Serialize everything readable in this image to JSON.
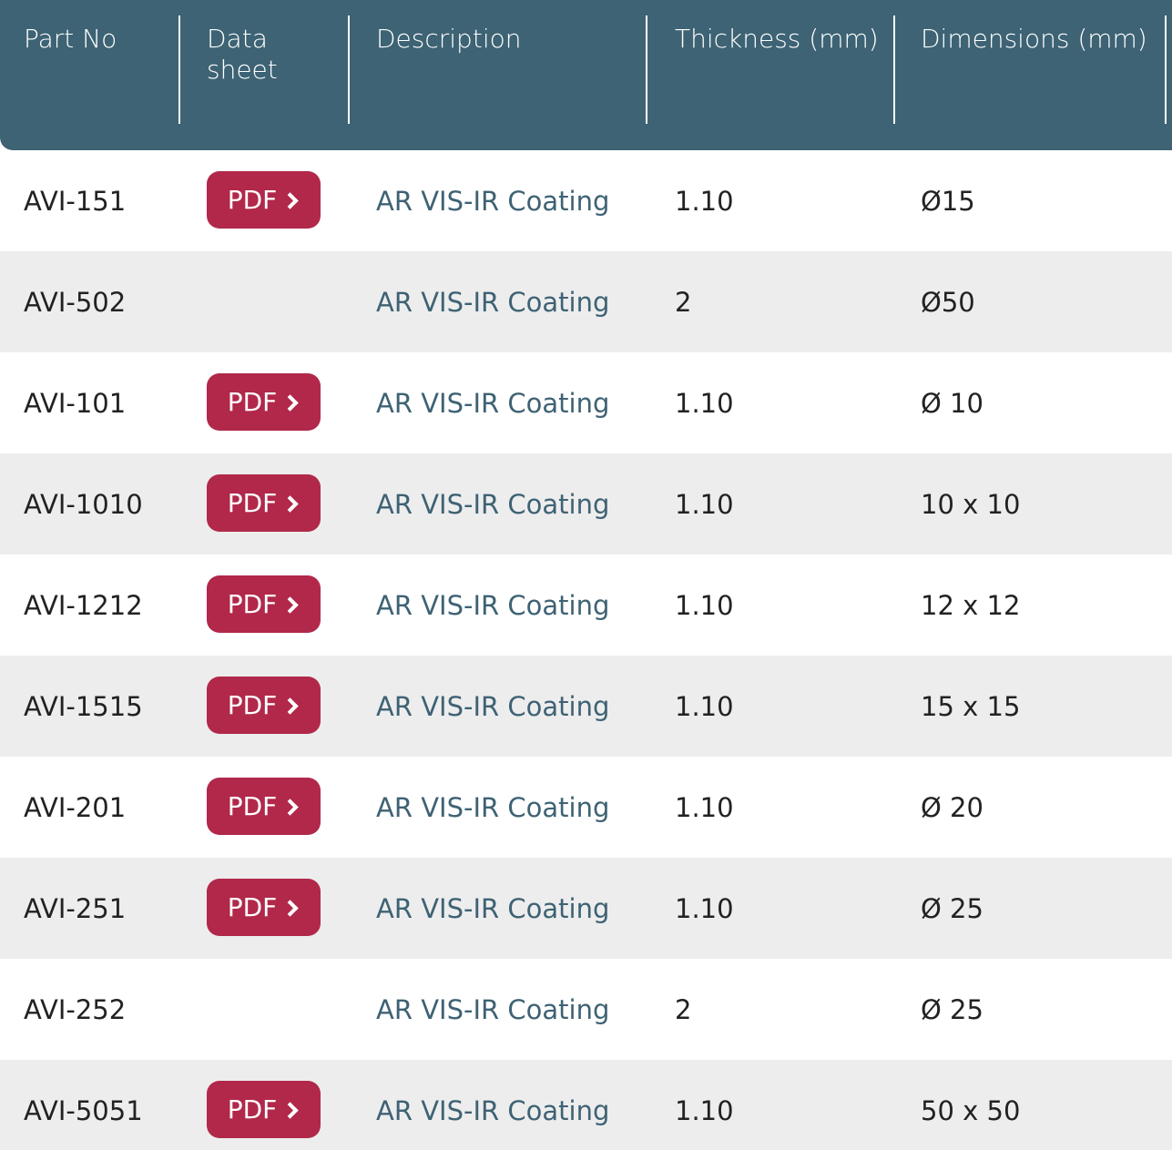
{
  "header": {
    "part_no": "Part No",
    "data_sheet": "Data sheet",
    "description": "Description",
    "thickness": "Thickness (mm)",
    "dimensions": "Dimensions (mm)"
  },
  "pdf_label": "PDF",
  "rows": [
    {
      "part_no": "AVI-151",
      "has_pdf": true,
      "description": "AR VIS-IR Coating",
      "thickness": "1.10",
      "dimensions": "Ø15"
    },
    {
      "part_no": "AVI-502",
      "has_pdf": false,
      "description": "AR VIS-IR Coating",
      "thickness": "2",
      "dimensions": "Ø50"
    },
    {
      "part_no": "AVI-101",
      "has_pdf": true,
      "description": "AR VIS-IR Coating",
      "thickness": "1.10",
      "dimensions": "Ø 10"
    },
    {
      "part_no": "AVI-1010",
      "has_pdf": true,
      "description": "AR VIS-IR Coating",
      "thickness": "1.10",
      "dimensions": "10 x 10"
    },
    {
      "part_no": "AVI-1212",
      "has_pdf": true,
      "description": "AR VIS-IR Coating",
      "thickness": "1.10",
      "dimensions": "12 x 12"
    },
    {
      "part_no": "AVI-1515",
      "has_pdf": true,
      "description": "AR VIS-IR Coating",
      "thickness": "1.10",
      "dimensions": "15 x 15"
    },
    {
      "part_no": "AVI-201",
      "has_pdf": true,
      "description": "AR VIS-IR Coating",
      "thickness": "1.10",
      "dimensions": "Ø 20"
    },
    {
      "part_no": "AVI-251",
      "has_pdf": true,
      "description": "AR VIS-IR Coating",
      "thickness": "1.10",
      "dimensions": "Ø 25"
    },
    {
      "part_no": "AVI-252",
      "has_pdf": false,
      "description": "AR VIS-IR Coating",
      "thickness": "2",
      "dimensions": "Ø 25"
    },
    {
      "part_no": "AVI-5051",
      "has_pdf": true,
      "description": "AR VIS-IR Coating",
      "thickness": "1.10",
      "dimensions": "50 x 50"
    }
  ],
  "colors": {
    "header_bg": "#3d6374",
    "pdf_button": "#b1284a",
    "description_text": "#3e6274",
    "alt_row": "#ededed"
  }
}
